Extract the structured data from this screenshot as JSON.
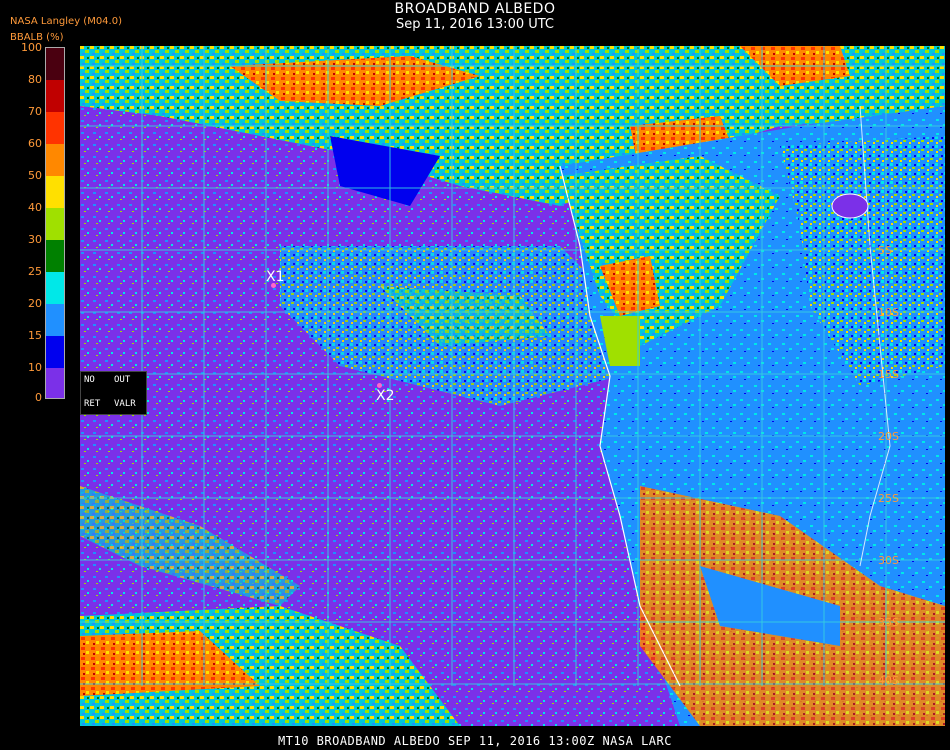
{
  "header": {
    "title": "BROADBAND ALBEDO",
    "subtitle": "Sep 11, 2016 13:00 UTC",
    "source": "NASA Langley (M04.0)",
    "variable": "BBALB (%)"
  },
  "legend": {
    "ticks": [
      "100",
      "80",
      "70",
      "60",
      "50",
      "40",
      "30",
      "25",
      "20",
      "15",
      "10",
      "0"
    ],
    "colors": [
      "#4a0010",
      "#c00000",
      "#ff3300",
      "#ff8800",
      "#ffe000",
      "#a0e000",
      "#008000",
      "#00e8e8",
      "#2090ff",
      "#0000ee",
      "#7b30e8"
    ]
  },
  "controls": {
    "no": "NO",
    "out": "OUT",
    "ret": "RET",
    "valr": "VALR"
  },
  "markers": {
    "x1": "X1",
    "x2": "X2"
  },
  "lat_labels": [
    "5S",
    "10S",
    "15S",
    "20S",
    "25S",
    "30S",
    "35S",
    "40S"
  ],
  "footer": "MT10   BROADBAND ALBEDO   SEP 11, 2016 13:00Z   NASA LARC"
}
